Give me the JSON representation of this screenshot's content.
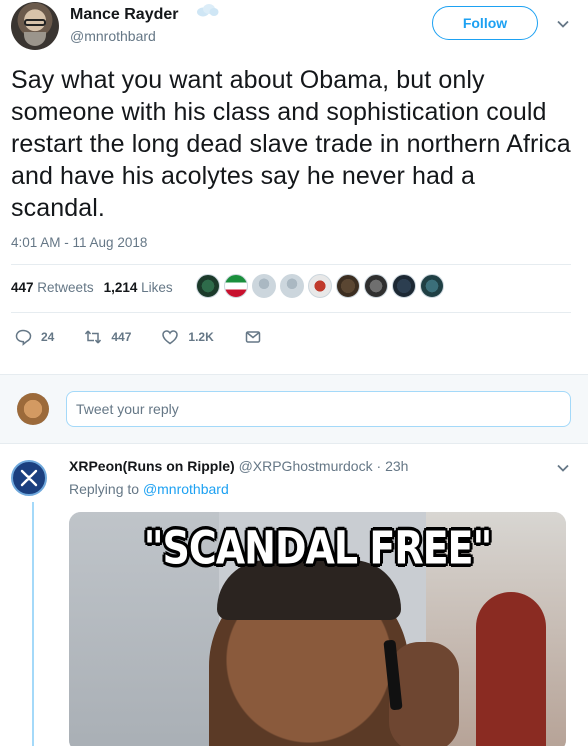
{
  "tweet": {
    "display_name": "Mance Rayder",
    "handle": "@mnrothbard",
    "follow_label": "Follow",
    "text": "Say what you want about Obama, but only someone with his class and sophistication could restart the long dead slave trade in northern Africa and have his acolytes say he never had a scandal.",
    "timestamp": "4:01 AM - 11 Aug 2018",
    "retweets_count": "447",
    "retweets_label": "Retweets",
    "likes_count": "1,214",
    "likes_label": "Likes",
    "actions": {
      "reply_count": "24",
      "retweet_count": "447",
      "like_count": "1.2K"
    },
    "colors": {
      "accent": "#1da1f2",
      "muted": "#657786",
      "text": "#14171a"
    }
  },
  "reply_box": {
    "placeholder": "Tweet your reply"
  },
  "reply": {
    "display_name": "XRPeon(Runs on Ripple)",
    "handle": "@XRPGhostmurdock",
    "time": "23h",
    "separator": "·",
    "replying_prefix": "Replying to",
    "replying_to": "@mnrothbard",
    "image_caption": "\"SCANDAL FREE\""
  }
}
